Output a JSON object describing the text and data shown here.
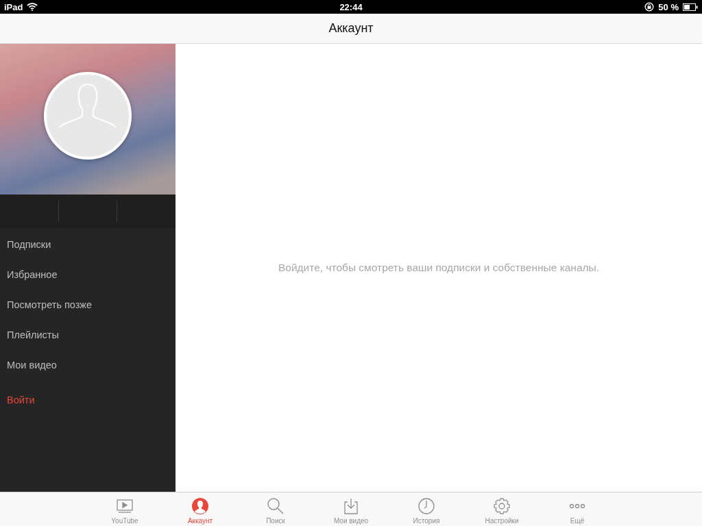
{
  "status_bar": {
    "device": "iPad",
    "time": "22:44",
    "battery": "50 %"
  },
  "nav_bar": {
    "title": "Аккаунт"
  },
  "sidebar": {
    "items": [
      {
        "label": "Подписки",
        "kind": "link"
      },
      {
        "label": "Избранное",
        "kind": "link"
      },
      {
        "label": "Посмотреть позже",
        "kind": "link"
      },
      {
        "label": "Плейлисты",
        "kind": "link"
      },
      {
        "label": "Мои видео",
        "kind": "link"
      },
      {
        "label": "Войти",
        "kind": "action"
      }
    ]
  },
  "content": {
    "message": "Войдите, чтобы смотреть ваши подписки и собственные каналы."
  },
  "tab_bar": [
    {
      "label": "YouTube",
      "kind": "youtube",
      "selected": false
    },
    {
      "label": "Аккаунт",
      "kind": "account",
      "selected": true
    },
    {
      "label": "Поиск",
      "kind": "search",
      "selected": false
    },
    {
      "label": "Мои видео",
      "kind": "downloads",
      "selected": false
    },
    {
      "label": "История",
      "kind": "history",
      "selected": false
    },
    {
      "label": "Настройки",
      "kind": "settings",
      "selected": false
    },
    {
      "label": "Ещё",
      "kind": "more",
      "selected": false
    }
  ]
}
